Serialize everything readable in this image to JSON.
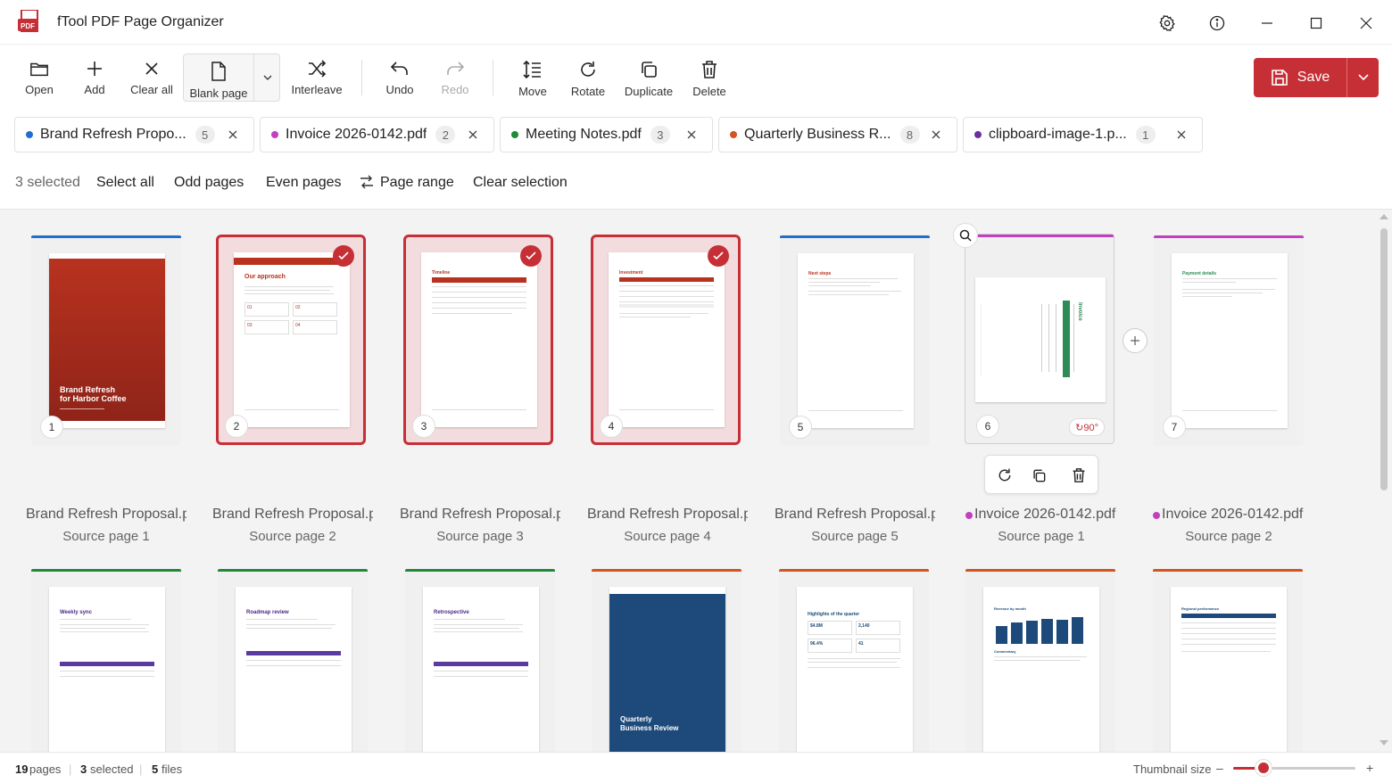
{
  "app": {
    "title": "fTool PDF Page Organizer"
  },
  "toolbar": {
    "open": "Open",
    "add": "Add",
    "clear_all": "Clear all",
    "blank_page": "Blank page",
    "interleave": "Interleave",
    "undo": "Undo",
    "redo": "Redo",
    "move": "Move",
    "rotate": "Rotate",
    "duplicate": "Duplicate",
    "delete": "Delete",
    "save": "Save"
  },
  "tabs": [
    {
      "name": "Brand Refresh Propo...",
      "count": "5",
      "color": "#1f6fd1"
    },
    {
      "name": "Invoice 2026-0142.pdf",
      "count": "2",
      "color": "#c23fbf"
    },
    {
      "name": "Meeting Notes.pdf",
      "count": "3",
      "color": "#1e8a3a"
    },
    {
      "name": "Quarterly Business R...",
      "count": "8",
      "color": "#d2541e"
    },
    {
      "name": "clipboard-image-1.p...",
      "count": "1",
      "color": "#6a2fa0"
    }
  ],
  "selection": {
    "count_label": "3 selected",
    "select_all": "Select all",
    "odd": "Odd pages",
    "even": "Even pages",
    "range": "Page range",
    "clear": "Clear selection"
  },
  "pages": [
    {
      "num": "1",
      "file": "Brand Refresh Proposal.p",
      "source": "Source page 1",
      "selected": false,
      "color": "#1f6fd1"
    },
    {
      "num": "2",
      "file": "Brand Refresh Proposal.p",
      "source": "Source page 2",
      "selected": true,
      "color": "#1f6fd1"
    },
    {
      "num": "3",
      "file": "Brand Refresh Proposal.p",
      "source": "Source page 3",
      "selected": true,
      "color": "#1f6fd1"
    },
    {
      "num": "4",
      "file": "Brand Refresh Proposal.p",
      "source": "Source page 4",
      "selected": true,
      "color": "#1f6fd1"
    },
    {
      "num": "5",
      "file": "Brand Refresh Proposal.p",
      "source": "Source page 5",
      "selected": false,
      "color": "#1f6fd1"
    },
    {
      "num": "6",
      "file": "Invoice 2026-0142.pdf",
      "source": "Source page 1",
      "selected": false,
      "color": "#c23fbf",
      "rotation": "↻90°"
    },
    {
      "num": "7",
      "file": "Invoice 2026-0142.pdf",
      "source": "Source page 2",
      "selected": false,
      "color": "#c23fbf"
    }
  ],
  "page_text": {
    "cover_title_1": "Brand Refresh",
    "cover_title_2": "for Harbor Coffee",
    "p2_heading": "Our approach",
    "p3_heading": "Timeline",
    "p4_heading": "Investment",
    "p5_heading": "Next steps",
    "p6_heading": "Invoice",
    "p7_heading": "Payment details",
    "p2_box_01": "01",
    "p2_box_02": "02",
    "p2_box_03": "03",
    "p2_box_04": "04",
    "r2_weekly": "Weekly sync",
    "r2_roadmap": "Roadmap review",
    "r2_retro": "Retrospective",
    "r2_quarterly_1": "Quarterly",
    "r2_quarterly_2": "Business Review",
    "r2_highlights": "Highlights of the quarter",
    "r2_h_val1": "$4.8M",
    "r2_h_val2": "2,140",
    "r2_h_val3": "96.4%",
    "r2_h_val4": "41",
    "r2_revenue": "Revenue by month",
    "r2_summary": "Commentary",
    "r2_regional": "Regional performance"
  },
  "footer": {
    "pages_num": "19",
    "pages_label": "pages",
    "selected_num": "3",
    "selected_label": "selected",
    "files_num": "5",
    "files_label": "files",
    "thumb_label": "Thumbnail size",
    "minus": "–",
    "plus": "+"
  },
  "thumbnail_size": 0.25,
  "colors": {
    "accent": "#c62f36",
    "brand_blue": "#1f6fd1",
    "invoice_pink": "#c23fbf",
    "meeting_green": "#1e8a3a",
    "quarterly_orange": "#d2541e"
  }
}
